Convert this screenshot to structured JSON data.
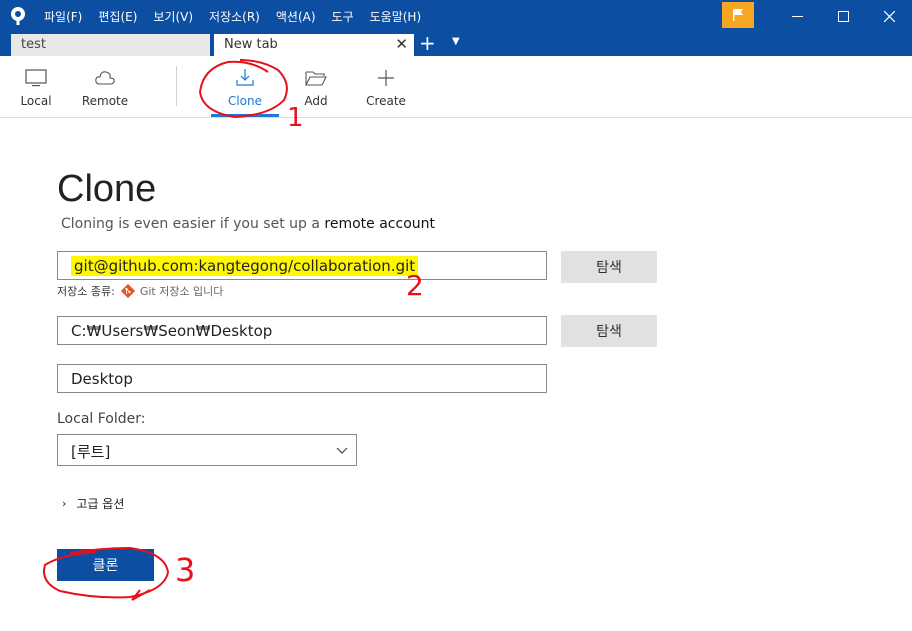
{
  "menu": [
    "파일(F)",
    "편집(E)",
    "보기(V)",
    "저장소(R)",
    "액션(A)",
    "도구",
    "도움말(H)"
  ],
  "tabs": {
    "first": "test",
    "active": "New tab",
    "close_glyph": "✕",
    "add_glyph": "+",
    "menu_glyph": "▼"
  },
  "toolbar": {
    "local": "Local",
    "remote": "Remote",
    "clone": "Clone",
    "add": "Add",
    "create": "Create"
  },
  "main": {
    "title": "Clone",
    "subtitle_prefix": "Cloning is even easier if you set up a ",
    "subtitle_link": "remote account",
    "source_url": "git@github.com:kangtegong/collaboration.git",
    "repo_type_label": "저장소 종류:",
    "repo_type_value": "Git 저장소 입니다",
    "dest_path": "C:₩Users₩Seon₩Desktop",
    "name": "Desktop",
    "browse_label": "탐색",
    "local_folder_label": "Local Folder:",
    "local_folder_value": "[루트]",
    "advanced_label": "고급 옵션",
    "advanced_arrow": "›",
    "clone_button": "클론"
  },
  "annotations": {
    "one": "1",
    "two": "2",
    "three": "3"
  },
  "colors": {
    "brand": "#0b4ea2",
    "accent": "#1e78d6",
    "highlight": "#fff700",
    "annotation": "#e8101a",
    "flag": "#f5a623"
  },
  "icons": [
    "sourcetree-logo-icon",
    "flag-icon",
    "minimize-icon",
    "maximize-icon",
    "close-icon",
    "monitor-icon",
    "cloud-icon",
    "download-icon",
    "folder-open-icon",
    "plus-icon",
    "git-icon",
    "chevron-down-icon"
  ]
}
